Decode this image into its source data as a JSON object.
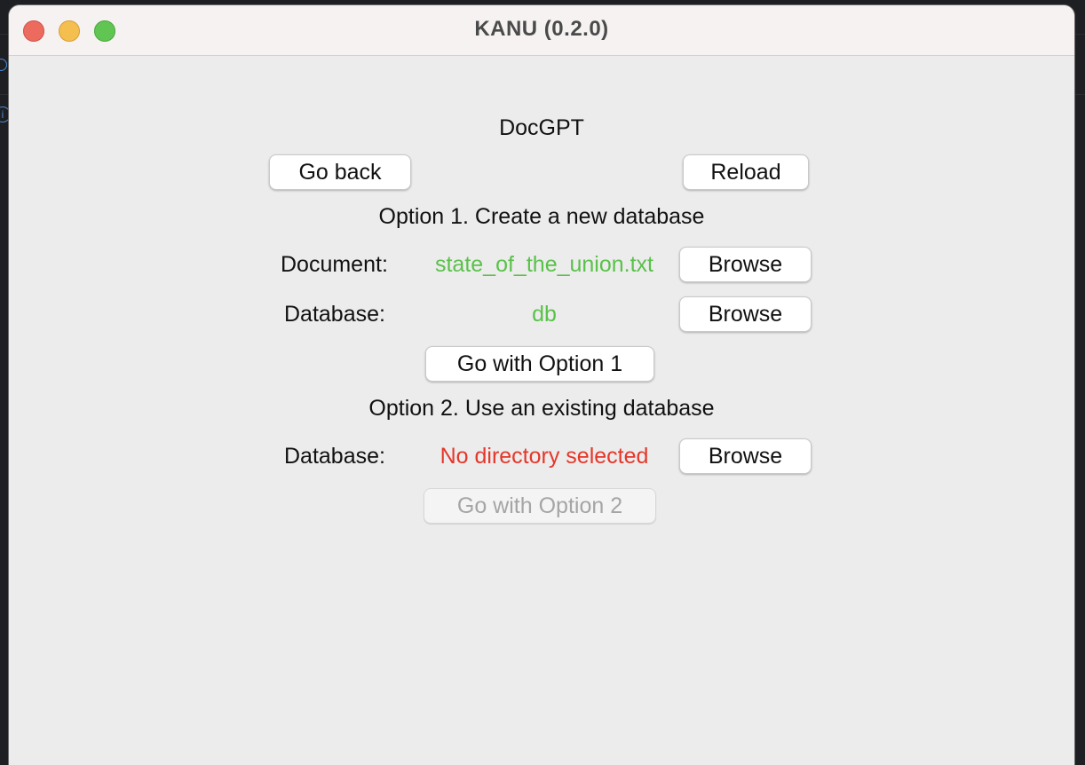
{
  "window": {
    "title": "KANU (0.2.0)"
  },
  "app": {
    "name": "DocGPT"
  },
  "nav": {
    "back_label": "Go back",
    "reload_label": "Reload"
  },
  "option1": {
    "heading": "Option 1. Create a new database",
    "document_label": "Document:",
    "document_value": "state_of_the_union.txt",
    "database_label": "Database:",
    "database_value": "db",
    "browse_label": "Browse",
    "go_label": "Go with Option 1",
    "value_color": "#5ac14a"
  },
  "option2": {
    "heading": "Option 2. Use an existing database",
    "database_label": "Database:",
    "database_value": "No directory selected",
    "browse_label": "Browse",
    "go_label": "Go with Option 2",
    "value_color": "#e5372a"
  }
}
